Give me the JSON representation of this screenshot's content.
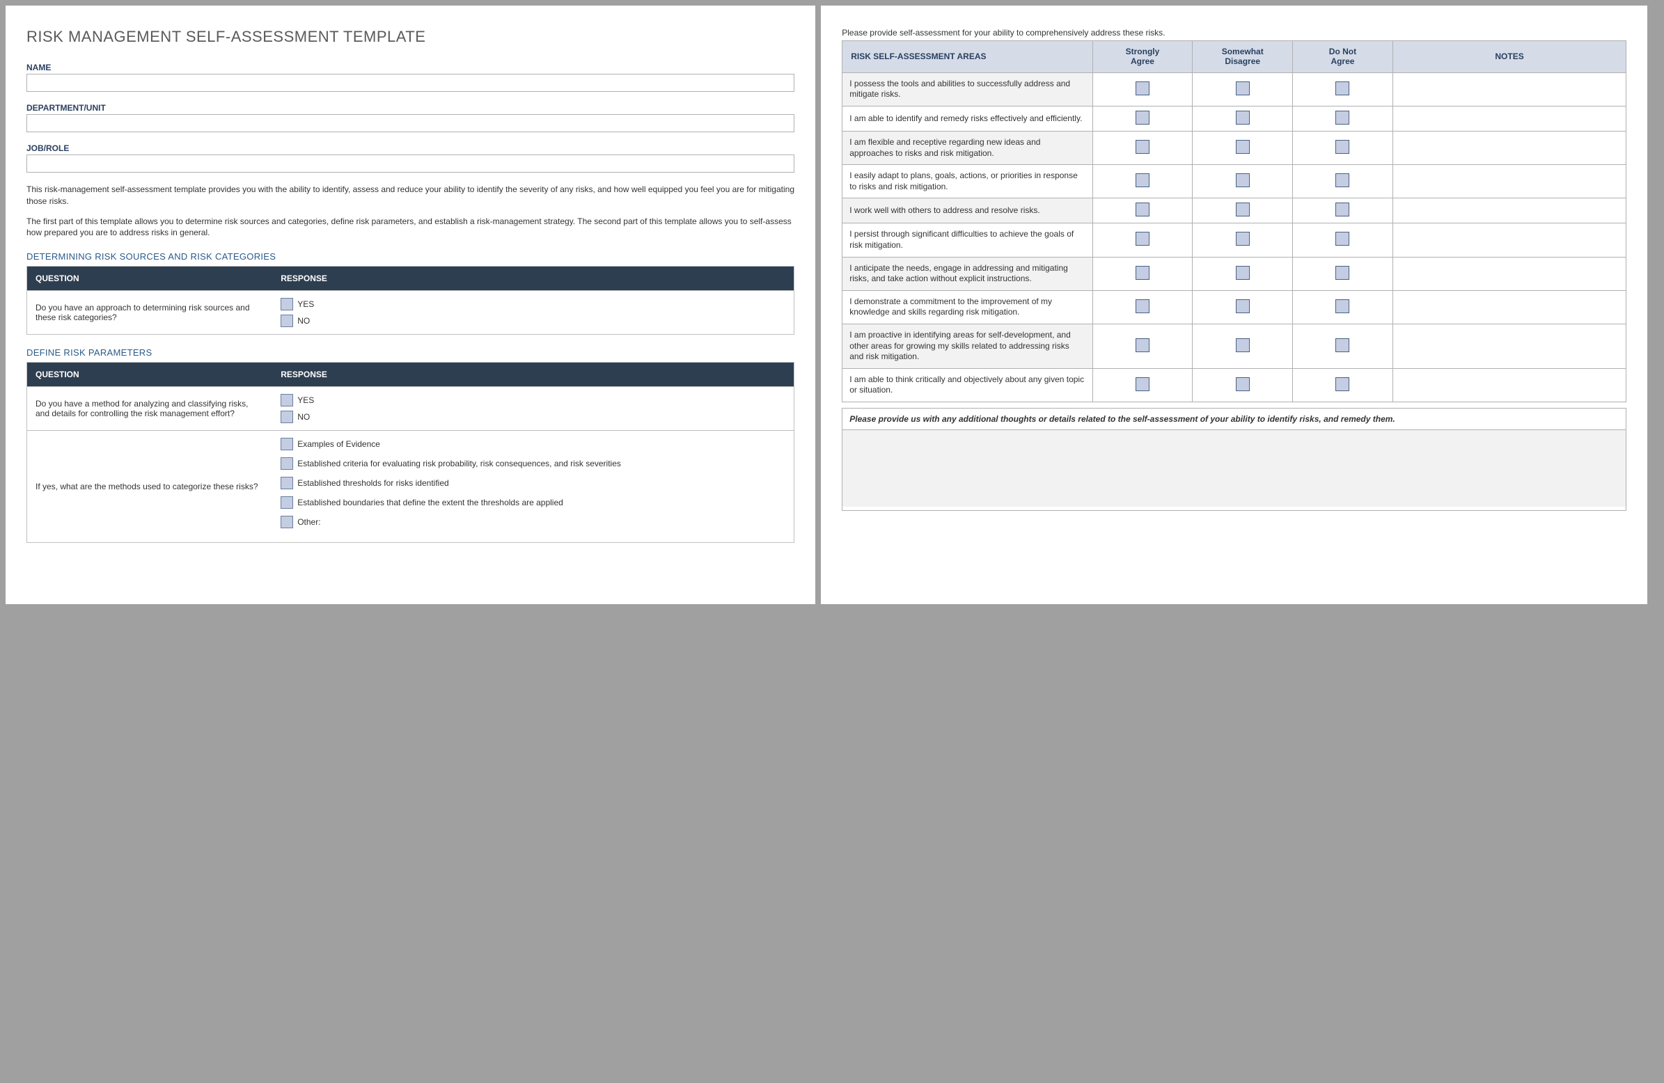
{
  "title": "RISK MANAGEMENT SELF-ASSESSMENT TEMPLATE",
  "fields": {
    "name_label": "NAME",
    "dept_label": "DEPARTMENT/UNIT",
    "role_label": "JOB/ROLE"
  },
  "intro": {
    "p1": "This risk-management self-assessment template provides you with the ability to identify, assess and reduce your ability to identify the severity of any risks, and how well equipped you feel you are for mitigating those risks.",
    "p2": "The first part of this template allows you to determine risk sources and categories, define risk parameters, and establish a risk-management strategy. The second part of this template allows you to self-assess how prepared you are to address risks in general."
  },
  "sections": {
    "sources": {
      "heading": "DETERMINING RISK SOURCES AND RISK CATEGORIES",
      "col_q": "QUESTION",
      "col_r": "RESPONSE",
      "question": "Do you have an approach to determining risk sources and these risk categories?",
      "yes": "YES",
      "no": "NO"
    },
    "params": {
      "heading": "DEFINE RISK PARAMETERS",
      "col_q": "QUESTION",
      "col_r": "RESPONSE",
      "q1": "Do you have a method for analyzing and classifying risks, and details for controlling the risk management effort?",
      "yes": "YES",
      "no": "NO",
      "q2": "If yes, what are the methods used to categorize these risks?",
      "opts": [
        "Examples of Evidence",
        "Established criteria for evaluating risk probability, risk consequences, and risk severities",
        "Established thresholds for risks identified",
        "Established boundaries that define the extent the thresholds are applied",
        "Other:"
      ]
    }
  },
  "assessment": {
    "instruction": "Please provide self-assessment for your ability to comprehensively address these risks.",
    "headers": {
      "area": "RISK SELF-ASSESSMENT AREAS",
      "sa": "Strongly Agree",
      "sd": "Somewhat Disagree",
      "dna": "Do Not Agree",
      "notes": "NOTES"
    },
    "rows": [
      "I possess the tools and abilities to successfully address and mitigate risks.",
      "I am able to identify and remedy risks effectively and efficiently.",
      "I am flexible and receptive regarding new ideas and approaches to risks and risk mitigation.",
      "I easily adapt to plans, goals, actions, or priorities in response to risks and risk mitigation.",
      "I work well with others to address and resolve risks.",
      "I persist through significant difficulties to achieve the goals of risk mitigation.",
      "I anticipate the needs, engage in addressing and mitigating risks, and take action without explicit instructions.",
      "I demonstrate a commitment to the improvement of my knowledge and skills regarding risk mitigation.",
      "I am proactive in identifying areas for self-development, and other areas for growing my skills related to addressing risks and risk mitigation.",
      "I am able to think critically and objectively about any given topic or situation."
    ],
    "additional_prompt": "Please provide us with any additional thoughts or details related to the self-assessment of your ability to identify risks, and remedy them."
  }
}
